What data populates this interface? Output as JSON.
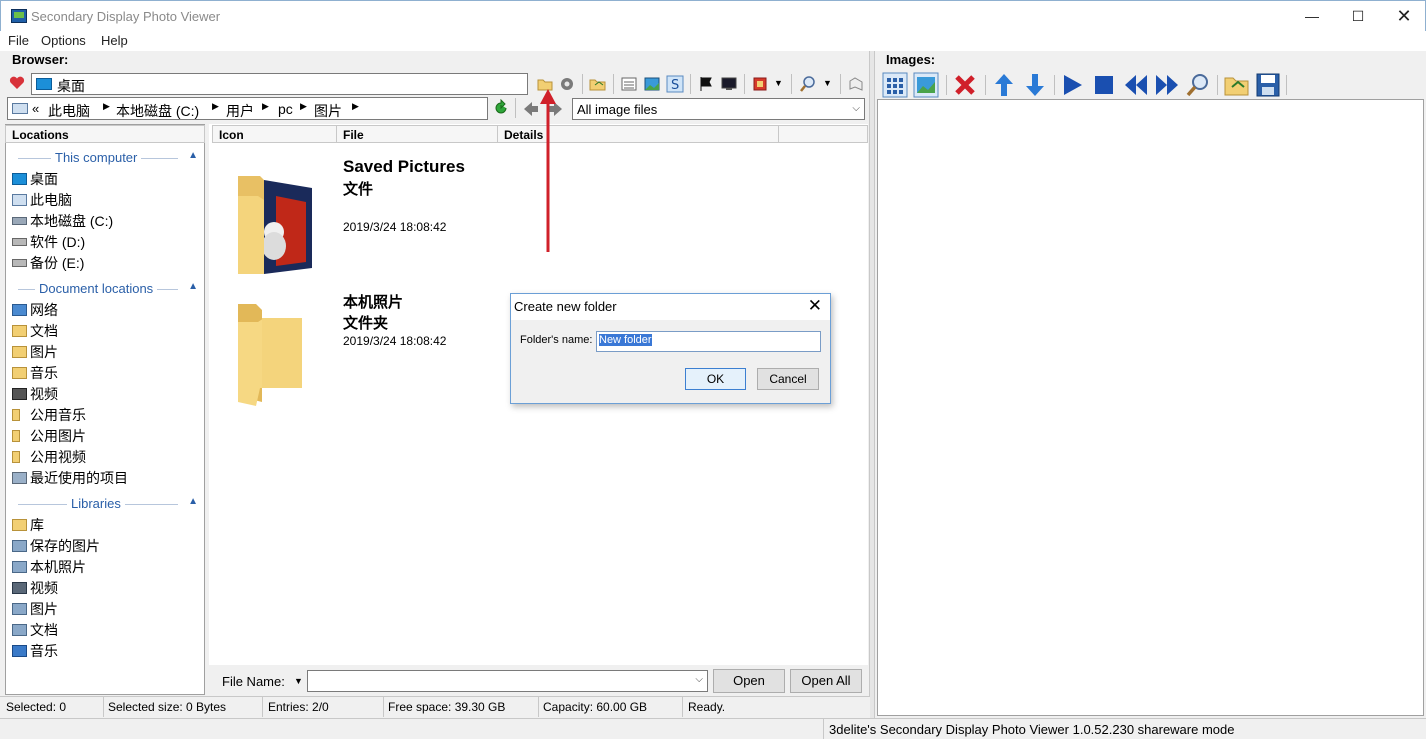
{
  "window": {
    "title": "Secondary Display Photo Viewer",
    "min": "—",
    "max": "☐",
    "close": "✕"
  },
  "menu": [
    "File",
    "Options",
    "Help"
  ],
  "browser": {
    "header": "Browser:",
    "path": "桌面",
    "breadcrumb": [
      "«",
      "此电脑",
      "本地磁盘 (C:)",
      "用户",
      "pc",
      "图片"
    ],
    "filter": "All image files"
  },
  "images": {
    "header": "Images:"
  },
  "columns": {
    "locations": "Locations",
    "icon": "Icon",
    "file": "File",
    "details": "Details"
  },
  "locations": {
    "sections": [
      {
        "label": "This computer",
        "items": [
          "桌面",
          "此电脑",
          "本地磁盘 (C:)",
          "软件 (D:)",
          "备份 (E:)"
        ]
      },
      {
        "label": "Document locations",
        "items": [
          "网络",
          "文档",
          "图片",
          "音乐",
          "视频",
          "公用音乐",
          "公用图片",
          "公用视频",
          "最近使用的项目"
        ]
      },
      {
        "label": "Libraries",
        "items": [
          "库",
          "保存的图片",
          "本机照片",
          "视频",
          "图片",
          "文档",
          "音乐"
        ]
      }
    ]
  },
  "files": [
    {
      "name": "Saved Pictures",
      "type": "文件",
      "date": "2019/3/24 18:08:42"
    },
    {
      "name": "本机照片",
      "type": "文件夹",
      "date": "2019/3/24 18:08:42"
    }
  ],
  "bottom": {
    "file_name_label": "File Name:",
    "file_name_value": "",
    "open": "Open",
    "open_all": "Open All"
  },
  "status": {
    "selected": "Selected: 0",
    "selected_size": "Selected size: 0 Bytes",
    "entries": "Entries: 2/0",
    "free_space": "Free space: 39.30 GB",
    "capacity": "Capacity: 60.00 GB",
    "state": "Ready.",
    "app_info": "3delite's Secondary Display Photo Viewer 1.0.52.230 shareware mode"
  },
  "dialog": {
    "title": "Create new folder",
    "label": "Folder's name:",
    "value": "New folder",
    "ok": "OK",
    "cancel": "Cancel"
  },
  "colors": {
    "accent": "#2a5fa8",
    "arrow": "#d0202a",
    "folder": "#f2cf73"
  }
}
